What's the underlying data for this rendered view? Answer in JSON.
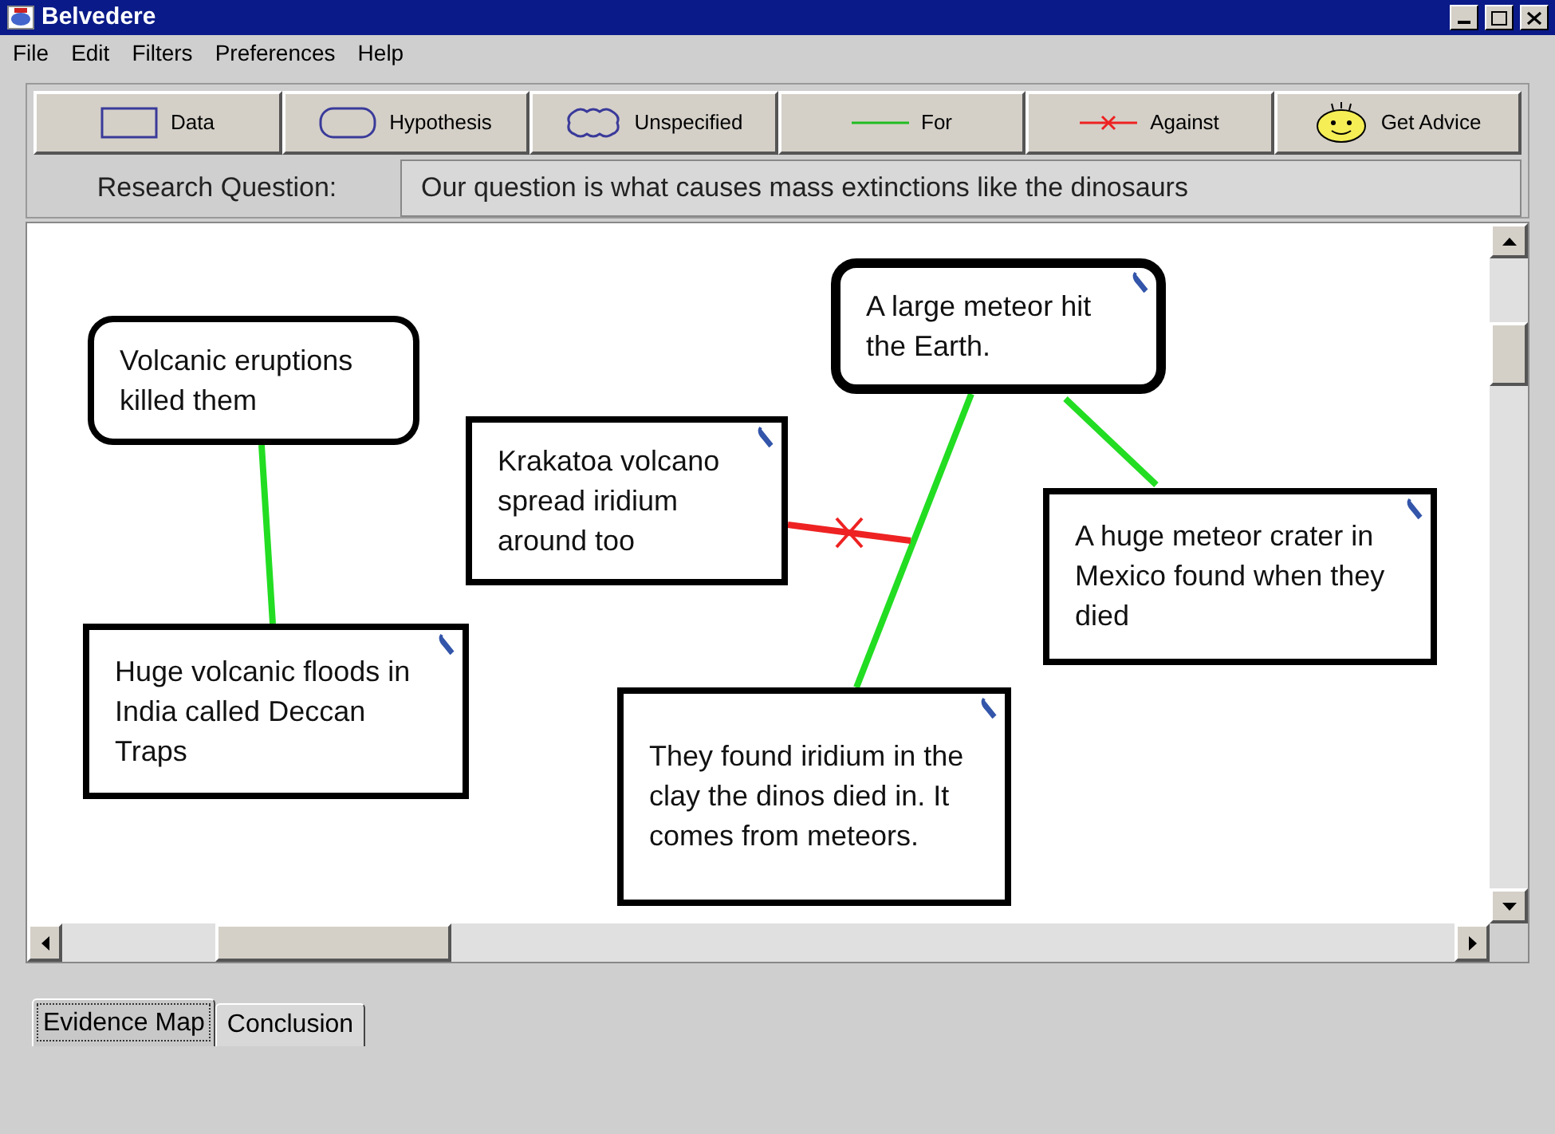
{
  "window": {
    "title": "Belvedere"
  },
  "menu": [
    "File",
    "Edit",
    "Filters",
    "Preferences",
    "Help"
  ],
  "toolbar": [
    {
      "kind": "data",
      "label": "Data"
    },
    {
      "kind": "hypothesis",
      "label": "Hypothesis"
    },
    {
      "kind": "unspecified",
      "label": "Unspecified"
    },
    {
      "kind": "for",
      "label": "For"
    },
    {
      "kind": "against",
      "label": "Against"
    },
    {
      "kind": "advice",
      "label": "Get Advice"
    }
  ],
  "research_question": {
    "label": "Research Question:",
    "value": "Our question is what causes mass extinctions like the dinosaurs"
  },
  "nodes": [
    {
      "kind": "hypothesis",
      "text": "Volcanic eruptions killed them",
      "selected": false,
      "attachment": false
    },
    {
      "kind": "hypothesis",
      "text": "A large meteor hit the Earth.",
      "selected": true,
      "attachment": true
    },
    {
      "kind": "data",
      "text": "Krakatoa volcano spread iridium around too",
      "selected": false,
      "attachment": true
    },
    {
      "kind": "data",
      "text": "A huge meteor crater in Mexico found when they died",
      "selected": false,
      "attachment": true
    },
    {
      "kind": "data",
      "text": "Huge volcanic floods in India called Deccan Traps",
      "selected": false,
      "attachment": true
    },
    {
      "kind": "data",
      "text": "They found iridium in the clay the dinos died in. It comes from meteors.",
      "selected": false,
      "attachment": true
    }
  ],
  "links": [
    {
      "kind": "for"
    },
    {
      "kind": "for"
    },
    {
      "kind": "for"
    },
    {
      "kind": "against"
    }
  ],
  "tabs": [
    {
      "label": "Evidence Map",
      "selected": true
    },
    {
      "label": "Conclusion",
      "selected": false
    }
  ]
}
